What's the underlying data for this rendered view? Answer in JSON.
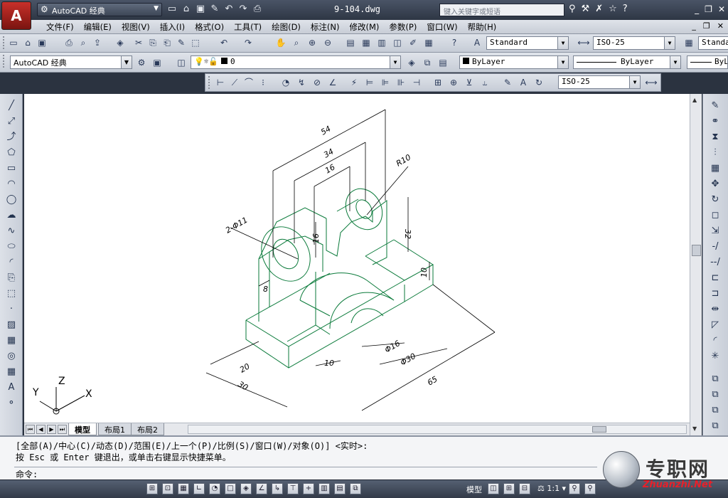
{
  "title_bar": {
    "app_logo": "A",
    "workspace": "AutoCAD 经典",
    "document_title": "9-104.dwg",
    "search_placeholder": "键入关键字或短语"
  },
  "menu": {
    "items": [
      "文件(F)",
      "编辑(E)",
      "视图(V)",
      "插入(I)",
      "格式(O)",
      "工具(T)",
      "绘图(D)",
      "标注(N)",
      "修改(M)",
      "参数(P)",
      "窗口(W)",
      "帮助(H)"
    ]
  },
  "toolbars": {
    "text_style": "Standard",
    "dim_style": "ISO-25",
    "table_style": "Standard",
    "workspace2": "AutoCAD 经典",
    "layer": "0",
    "color": "ByLayer",
    "linetype": "ByLayer",
    "lineweight": "ByLayer",
    "dim_style2": "ISO-25"
  },
  "drawing": {
    "dims": {
      "d54": "54",
      "d34": "34",
      "d16top": "16",
      "r10": "R10",
      "hole": "2-Φ11",
      "d32": "32",
      "d16side": "16",
      "d8": "8",
      "d10": "10",
      "d20": "20",
      "d30": "30",
      "d10b": "10",
      "phi16": "Φ16",
      "phi30": "Φ30",
      "d65": "65"
    },
    "ucs": {
      "x": "X",
      "y": "Y",
      "z": "Z"
    },
    "line_color": "#0a7a3a",
    "dim_color": "#000000"
  },
  "layout_tabs": [
    "模型",
    "布局1",
    "布局2"
  ],
  "command": {
    "line1": "[全部(A)/中心(C)/动态(D)/范围(E)/上一个(P)/比例(S)/窗口(W)/对象(O)] <实时>:",
    "line2": "按 Esc 或 Enter 键退出，或单击右键显示快捷菜单。",
    "prompt": "命令:"
  },
  "status": {
    "model": "模型",
    "scale": "1:1"
  },
  "watermark": {
    "text": "专职网",
    "url": "Zhuanzhi.Net"
  }
}
